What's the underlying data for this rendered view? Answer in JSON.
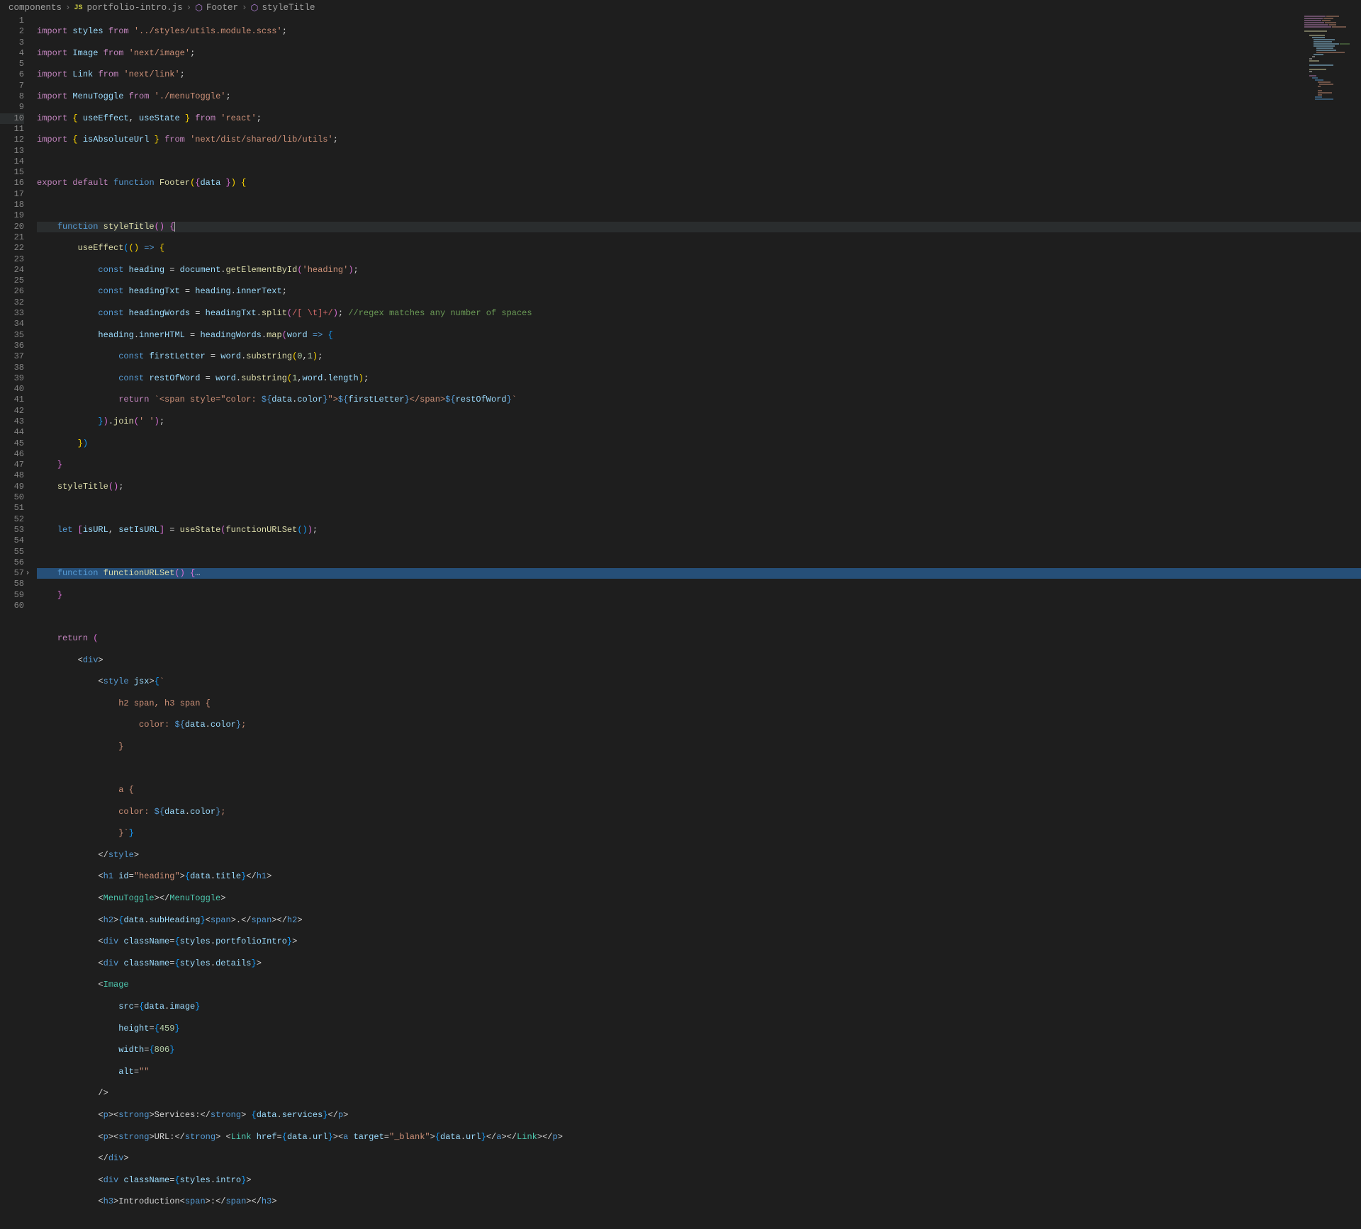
{
  "breadcrumb": {
    "folder": "components",
    "file": "portfolio-intro.js",
    "symbol1": "Footer",
    "symbol2": "styleTitle"
  },
  "lineNumbers": [
    1,
    2,
    3,
    4,
    5,
    6,
    7,
    8,
    9,
    10,
    11,
    12,
    13,
    14,
    15,
    16,
    17,
    18,
    19,
    20,
    21,
    22,
    23,
    24,
    25,
    26,
    32,
    33,
    34,
    35,
    36,
    37,
    38,
    39,
    40,
    41,
    42,
    43,
    44,
    45,
    46,
    47,
    48,
    49,
    50,
    51,
    52,
    53,
    54,
    55,
    56,
    57,
    58,
    59,
    60
  ],
  "code": {
    "l1": {
      "kw1": "import",
      "var": "styles",
      "kw2": "from",
      "str": "'../styles/utils.module.scss'"
    },
    "l2": {
      "kw1": "import",
      "var": "Image",
      "kw2": "from",
      "str": "'next/image'"
    },
    "l3": {
      "kw1": "import",
      "var": "Link",
      "kw2": "from",
      "str": "'next/link'"
    },
    "l4": {
      "kw1": "import",
      "var": "MenuToggle",
      "kw2": "from",
      "str": "'./menuToggle'"
    },
    "l5": {
      "kw1": "import",
      "v1": "useEffect",
      "v2": "useState",
      "kw2": "from",
      "str": "'react'"
    },
    "l6": {
      "kw1": "import",
      "v1": "isAbsoluteUrl",
      "kw2": "from",
      "str": "'next/dist/shared/lib/utils'"
    },
    "l8": {
      "kw1": "export",
      "kw2": "default",
      "kw3": "function",
      "fn": "Footer",
      "param": "data"
    },
    "l10": {
      "kw": "function",
      "fn": "styleTitle"
    },
    "l11": {
      "fn": "useEffect"
    },
    "l12": {
      "kw": "const",
      "v": "heading",
      "obj": "document",
      "fn": "getElementById",
      "str": "'heading'"
    },
    "l13": {
      "kw": "const",
      "v": "headingTxt",
      "obj": "heading",
      "prop": "innerText"
    },
    "l14": {
      "kw": "const",
      "v": "headingWords",
      "obj": "headingTxt",
      "fn": "split",
      "regex": "/[ \\t]+/",
      "cmt": "//regex matches any number of spaces"
    },
    "l15": {
      "obj": "heading",
      "prop": "innerHTML",
      "v2": "headingWords",
      "fn": "map",
      "param": "word"
    },
    "l16": {
      "kw": "const",
      "v": "firstLetter",
      "obj": "word",
      "fn": "substring",
      "a": "0",
      "b": "1"
    },
    "l17": {
      "kw": "const",
      "v": "restOfWord",
      "obj": "word",
      "fn": "substring",
      "a": "1",
      "b1": "word",
      "b2": "length"
    },
    "l18": {
      "kw": "return",
      "t1": "`<span style=\"color: ",
      "d": "data",
      "c": "color",
      "mid": "\">",
      "v1": "firstLetter",
      "t2": "</span>",
      "v2": "restOfWord",
      "end": "`"
    },
    "l19": {
      "fn": "join",
      "str": "' '"
    },
    "l22": {
      "fn": "styleTitle"
    },
    "l24": {
      "kw": "let",
      "v1": "isURL",
      "v2": "setIsURL",
      "fn": "useState",
      "call": "functionURLSet"
    },
    "l26": {
      "kw": "function",
      "fn": "functionURLSet",
      "fold": "…"
    },
    "l34": {
      "kw": "return"
    },
    "l35": {
      "tag": "div"
    },
    "l36": {
      "tag": "style",
      "attr": "jsx"
    },
    "l37": {
      "txt": "h2 span, h3 span {"
    },
    "l38": {
      "txt": "color: ",
      "d": "data",
      "c": "color"
    },
    "l39": {
      "txt": "}"
    },
    "l41": {
      "txt": "a {"
    },
    "l42": {
      "txt": "color: ",
      "d": "data",
      "c": "color"
    },
    "l43": {
      "txt": "}`}"
    },
    "l44": {
      "tag": "style"
    },
    "l45": {
      "tag": "h1",
      "attr": "id",
      "val": "\"heading\"",
      "d": "data",
      "p": "title"
    },
    "l46": {
      "tag": "MenuToggle"
    },
    "l47": {
      "tag": "h2",
      "d": "data",
      "p": "subHeading",
      "tag2": "span"
    },
    "l48": {
      "tag": "div",
      "attr": "className",
      "obj": "styles",
      "p": "portfolioIntro"
    },
    "l49": {
      "tag": "div",
      "attr": "className",
      "obj": "styles",
      "p": "details"
    },
    "l50": {
      "tag": "Image"
    },
    "l51": {
      "attr": "src",
      "d": "data",
      "p": "image"
    },
    "l52": {
      "attr": "height",
      "v": "459"
    },
    "l53": {
      "attr": "width",
      "v": "806"
    },
    "l54": {
      "attr": "alt",
      "v": "\"\""
    },
    "l56": {
      "tag": "p",
      "tag2": "strong",
      "txt": "Services:",
      "d": "data",
      "p": "services"
    },
    "l57": {
      "tag": "p",
      "tag2": "strong",
      "txt": "URL:",
      "tag3": "Link",
      "attr": "href",
      "d": "data",
      "p": "url",
      "tag4": "a",
      "attr2": "target",
      "val2": "\"_blank\""
    },
    "l58": {
      "tag": "div"
    },
    "l59": {
      "tag": "div",
      "attr": "className",
      "obj": "styles",
      "p": "intro"
    },
    "l60": {
      "tag": "h3",
      "txt": "Introduction",
      "tag2": "span"
    }
  }
}
